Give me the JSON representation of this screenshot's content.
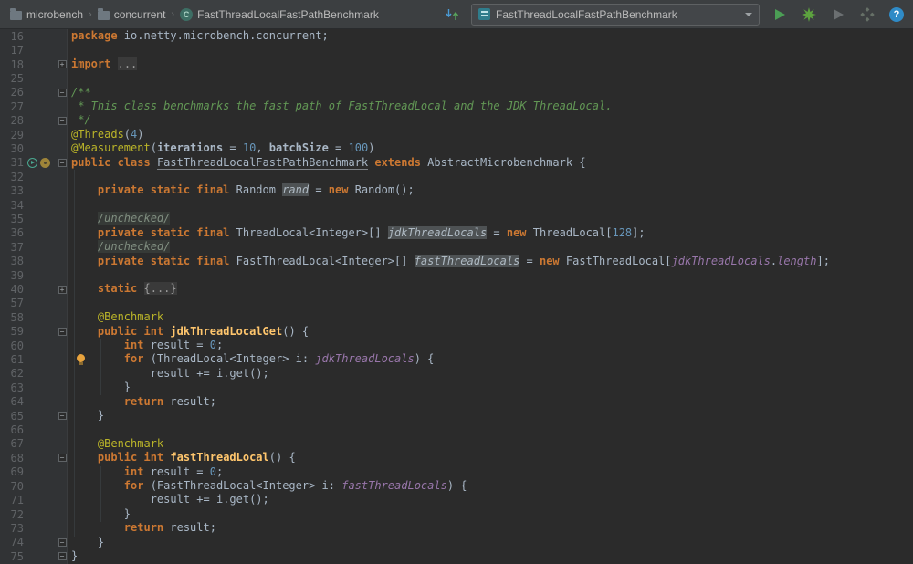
{
  "topbar": {
    "separator": "›",
    "breadcrumbs": [
      {
        "icon": "folder-icon",
        "label": "microbench"
      },
      {
        "icon": "folder-icon",
        "label": "concurrent"
      },
      {
        "icon": "class-icon",
        "label": "FastThreadLocalFastPathBenchmark"
      }
    ],
    "run_config": {
      "icon": "run-config-icon",
      "label": "FastThreadLocalFastPathBenchmark"
    },
    "help_label": "?",
    "actions": [
      {
        "name": "run-button",
        "icon": "play-icon",
        "enabled": true
      },
      {
        "name": "run-coverage-button",
        "icon": "coverage-star-icon",
        "enabled": true
      },
      {
        "name": "profile-button",
        "icon": "play-icon",
        "enabled": false
      },
      {
        "name": "concurrency-diagram-button",
        "icon": "diamond-grid-icon",
        "enabled": false
      },
      {
        "name": "help-button",
        "icon": "question-icon",
        "enabled": true
      }
    ]
  },
  "colors": {
    "editor_bg": "#2B2B2B",
    "gutter_bg": "#313335",
    "topbar_bg": "#3C3F41",
    "keyword": "#CC7832",
    "annotation": "#BBB529",
    "number": "#6897BB",
    "field": "#9876AA",
    "method": "#FFC66D",
    "comment": "#629755",
    "text": "#A9B7C6",
    "run_green": "#4B9E55",
    "help_blue": "#2F8BC7"
  },
  "editor": {
    "lines": [
      {
        "n": "16",
        "t": [
          [
            "k",
            "package"
          ],
          [
            "p",
            " io.netty.microbench.concurrent;"
          ]
        ]
      },
      {
        "n": "17",
        "t": []
      },
      {
        "n": "18",
        "f": "plus",
        "t": [
          [
            "k",
            "import"
          ],
          [
            "p",
            " "
          ],
          [
            "fo",
            "..."
          ]
        ]
      },
      {
        "n": "25",
        "t": []
      },
      {
        "n": "26",
        "f": "minus",
        "t": [
          [
            "c",
            "/**"
          ]
        ]
      },
      {
        "n": "27",
        "t": [
          [
            "c",
            " * This class benchmarks the fast path of FastThreadLocal and the JDK ThreadLocal."
          ]
        ]
      },
      {
        "n": "28",
        "f": "end",
        "t": [
          [
            "c",
            " */"
          ]
        ]
      },
      {
        "n": "29",
        "t": [
          [
            "a",
            "@Threads"
          ],
          [
            "p",
            "("
          ],
          [
            "n",
            "4"
          ],
          [
            "p",
            ")"
          ]
        ]
      },
      {
        "n": "30",
        "t": [
          [
            "a",
            "@Measurement"
          ],
          [
            "p",
            "("
          ],
          [
            "b",
            "iterations"
          ],
          [
            "p",
            " = "
          ],
          [
            "n",
            "10"
          ],
          [
            "p",
            ", "
          ],
          [
            "b",
            "batchSize"
          ],
          [
            "p",
            " = "
          ],
          [
            "n",
            "100"
          ],
          [
            "p",
            ")"
          ]
        ]
      },
      {
        "n": "31",
        "f": "minus",
        "g": [
          "run-marker",
          "override-marker"
        ],
        "t": [
          [
            "k",
            "public class"
          ],
          [
            "p",
            " "
          ],
          [
            "cls",
            "FastThreadLocalFastPathBenchmark"
          ],
          [
            "p",
            " "
          ],
          [
            "k",
            "extends"
          ],
          [
            "p",
            " AbstractMicrobenchmark {"
          ]
        ]
      },
      {
        "n": "32",
        "t": []
      },
      {
        "n": "33",
        "t": [
          [
            "p",
            "    "
          ],
          [
            "k",
            "private static final"
          ],
          [
            "p",
            " Random "
          ],
          [
            "fh",
            "rand"
          ],
          [
            "p",
            " = "
          ],
          [
            "k",
            "new"
          ],
          [
            "p",
            " Random();"
          ]
        ]
      },
      {
        "n": "34",
        "t": []
      },
      {
        "n": "35",
        "t": [
          [
            "p",
            "    "
          ],
          [
            "foi",
            "/unchecked/"
          ]
        ]
      },
      {
        "n": "36",
        "t": [
          [
            "p",
            "    "
          ],
          [
            "k",
            "private static final"
          ],
          [
            "p",
            " ThreadLocal<Integer>[] "
          ],
          [
            "fh",
            "jdkThreadLocals"
          ],
          [
            "p",
            " = "
          ],
          [
            "k",
            "new"
          ],
          [
            "p",
            " ThreadLocal["
          ],
          [
            "n",
            "128"
          ],
          [
            "p",
            "];"
          ]
        ]
      },
      {
        "n": "37",
        "t": [
          [
            "p",
            "    "
          ],
          [
            "foi",
            "/unchecked/"
          ]
        ]
      },
      {
        "n": "38",
        "t": [
          [
            "p",
            "    "
          ],
          [
            "k",
            "private static final"
          ],
          [
            "p",
            " FastThreadLocal<Integer>[] "
          ],
          [
            "fh",
            "fastThreadLocals"
          ],
          [
            "p",
            " = "
          ],
          [
            "k",
            "new"
          ],
          [
            "p",
            " FastThreadLocal["
          ],
          [
            "f",
            "jdkThreadLocals"
          ],
          [
            "p",
            "."
          ],
          [
            "f",
            "length"
          ],
          [
            "p",
            "];"
          ]
        ]
      },
      {
        "n": "39",
        "t": []
      },
      {
        "n": "40",
        "f": "plus",
        "t": [
          [
            "p",
            "    "
          ],
          [
            "k",
            "static"
          ],
          [
            "p",
            " "
          ],
          [
            "fo",
            "{...}"
          ]
        ]
      },
      {
        "n": "57",
        "t": []
      },
      {
        "n": "58",
        "t": [
          [
            "p",
            "    "
          ],
          [
            "a",
            "@Benchmark"
          ]
        ]
      },
      {
        "n": "59",
        "f": "minus",
        "t": [
          [
            "p",
            "    "
          ],
          [
            "k",
            "public int"
          ],
          [
            "p",
            " "
          ],
          [
            "m",
            "jdkThreadLocalGet"
          ],
          [
            "p",
            "() {"
          ]
        ]
      },
      {
        "n": "60",
        "t": [
          [
            "p",
            "        "
          ],
          [
            "k",
            "int"
          ],
          [
            "p",
            " result = "
          ],
          [
            "n",
            "0"
          ],
          [
            "p",
            ";"
          ]
        ]
      },
      {
        "n": "61",
        "bulb": true,
        "t": [
          [
            "p",
            "        "
          ],
          [
            "k",
            "for"
          ],
          [
            "p",
            " (ThreadLocal<Integer> i: "
          ],
          [
            "f",
            "jdkThreadLocals"
          ],
          [
            "p",
            ") {"
          ]
        ]
      },
      {
        "n": "62",
        "t": [
          [
            "p",
            "            result += i.get();"
          ]
        ]
      },
      {
        "n": "63",
        "t": [
          [
            "p",
            "        }"
          ]
        ]
      },
      {
        "n": "64",
        "t": [
          [
            "p",
            "        "
          ],
          [
            "k",
            "return"
          ],
          [
            "p",
            " result;"
          ]
        ]
      },
      {
        "n": "65",
        "f": "end",
        "t": [
          [
            "p",
            "    }"
          ]
        ]
      },
      {
        "n": "66",
        "t": []
      },
      {
        "n": "67",
        "t": [
          [
            "p",
            "    "
          ],
          [
            "a",
            "@Benchmark"
          ]
        ]
      },
      {
        "n": "68",
        "f": "minus",
        "t": [
          [
            "p",
            "    "
          ],
          [
            "k",
            "public int"
          ],
          [
            "p",
            " "
          ],
          [
            "m",
            "fastThreadLocal"
          ],
          [
            "p",
            "() {"
          ]
        ]
      },
      {
        "n": "69",
        "t": [
          [
            "p",
            "        "
          ],
          [
            "k",
            "int"
          ],
          [
            "p",
            " result = "
          ],
          [
            "n",
            "0"
          ],
          [
            "p",
            ";"
          ]
        ]
      },
      {
        "n": "70",
        "t": [
          [
            "p",
            "        "
          ],
          [
            "k",
            "for"
          ],
          [
            "p",
            " (FastThreadLocal<Integer> i: "
          ],
          [
            "f",
            "fastThreadLocals"
          ],
          [
            "p",
            ") {"
          ]
        ]
      },
      {
        "n": "71",
        "t": [
          [
            "p",
            "            result += i.get();"
          ]
        ]
      },
      {
        "n": "72",
        "t": [
          [
            "p",
            "        }"
          ]
        ]
      },
      {
        "n": "73",
        "t": [
          [
            "p",
            "        "
          ],
          [
            "k",
            "return"
          ],
          [
            "p",
            " result;"
          ]
        ]
      },
      {
        "n": "74",
        "f": "end",
        "t": [
          [
            "p",
            "    }"
          ]
        ]
      },
      {
        "n": "75",
        "f": "end",
        "t": [
          [
            "p",
            "}"
          ]
        ]
      }
    ]
  }
}
